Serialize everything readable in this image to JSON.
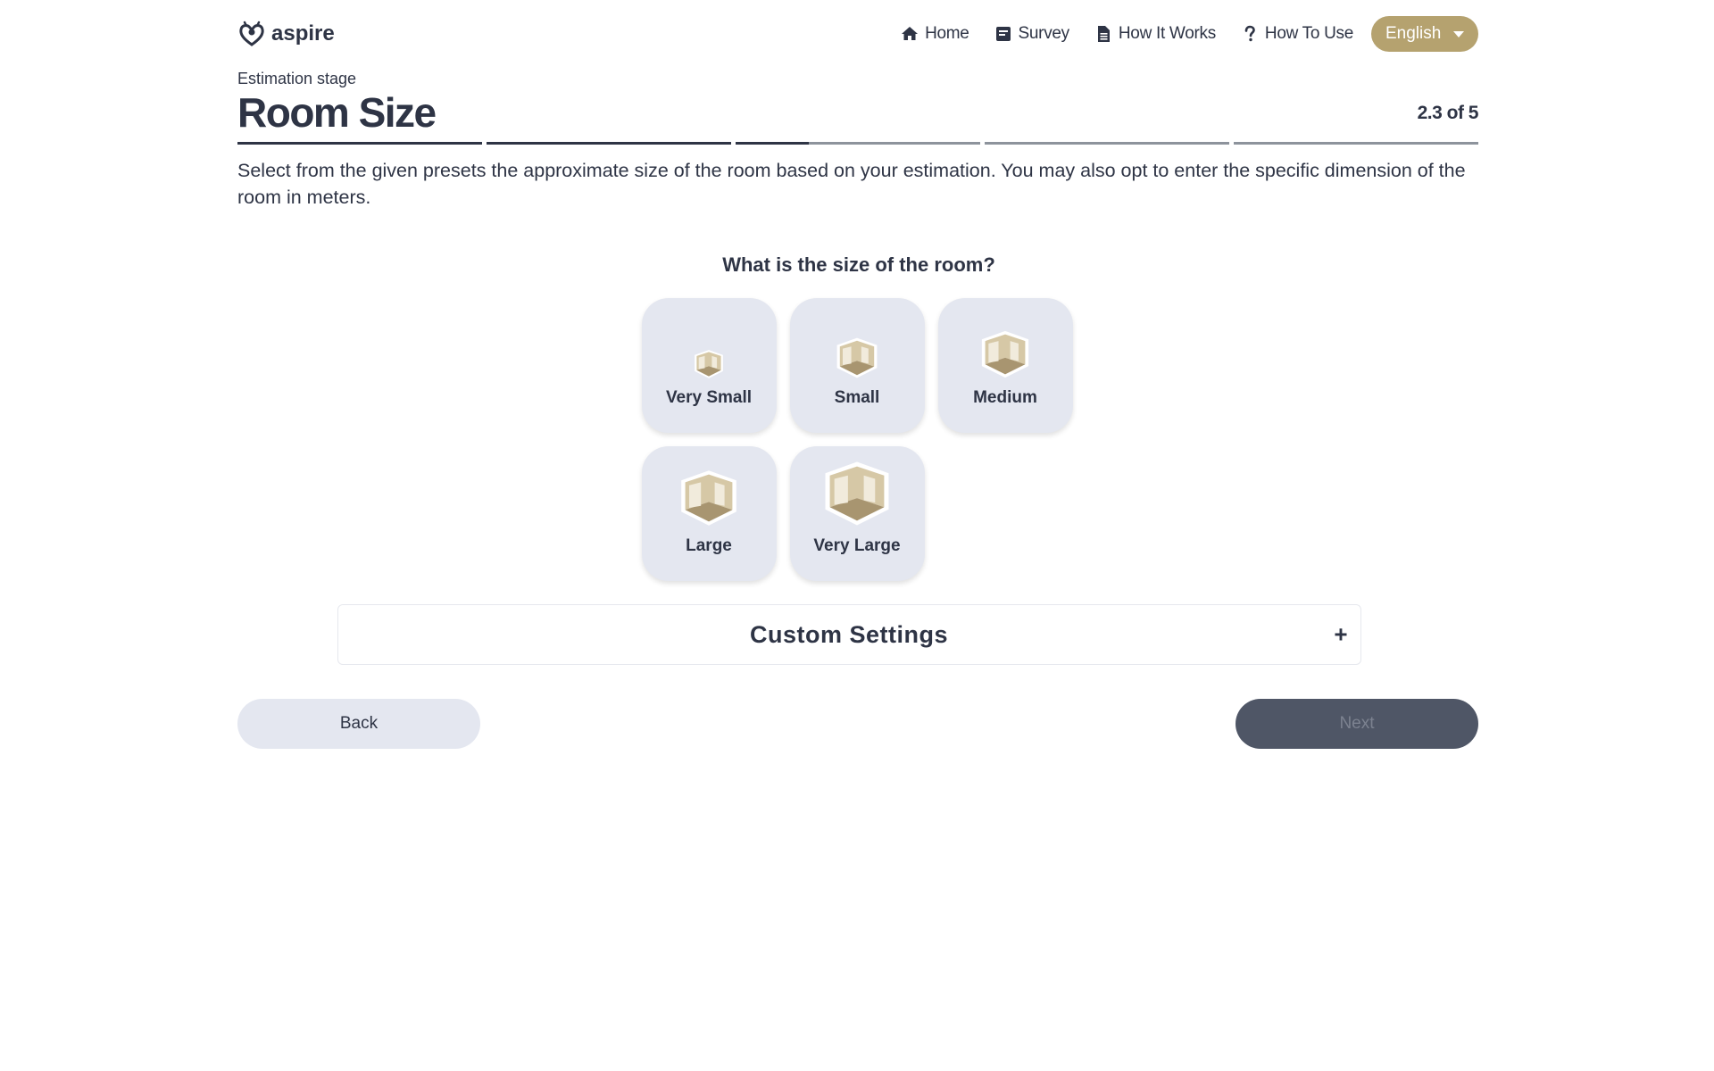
{
  "brand": {
    "name": "aspire"
  },
  "nav": {
    "items": [
      {
        "label": "Home",
        "icon": "home-icon"
      },
      {
        "label": "Survey",
        "icon": "survey-icon"
      },
      {
        "label": "How It Works",
        "icon": "document-icon"
      },
      {
        "label": "How To Use",
        "icon": "question-icon"
      }
    ],
    "language": {
      "selected": "English"
    }
  },
  "page": {
    "stage": "Estimation stage",
    "title": "Room Size",
    "step_counter": "2.3 of 5",
    "progress": {
      "segments": 5,
      "completed": 2.3
    },
    "description": "Select from the given presets the approximate size of the room based on your estimation. You may also opt to enter the specific dimension of the room in meters."
  },
  "question": {
    "text": "What is the size of the room?",
    "options": [
      {
        "label": "Very Small",
        "icon": "room-very-small-icon"
      },
      {
        "label": "Small",
        "icon": "room-small-icon"
      },
      {
        "label": "Medium",
        "icon": "room-medium-icon"
      },
      {
        "label": "Large",
        "icon": "room-large-icon"
      },
      {
        "label": "Very Large",
        "icon": "room-very-large-icon"
      }
    ]
  },
  "custom_settings": {
    "label": "Custom Settings",
    "toggle": "+"
  },
  "actions": {
    "back_label": "Back",
    "next_label": "Next"
  },
  "colors": {
    "accent": "#b5a26f",
    "text": "#2e3445",
    "card_bg": "#e4e7f0",
    "next_disabled": "#4f5666"
  }
}
